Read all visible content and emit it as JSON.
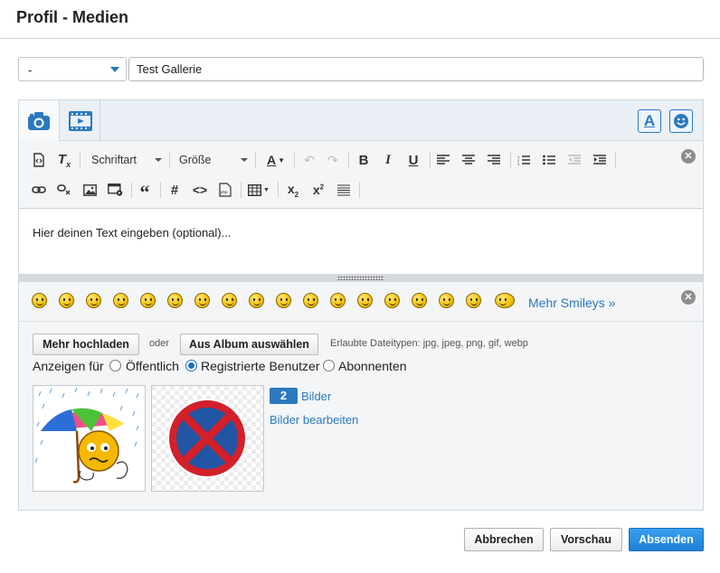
{
  "title": "Profil - Medien",
  "album_select": {
    "value": "-"
  },
  "title_input": {
    "value": "Test Gallerie"
  },
  "media_tabs": {
    "photo_icon": "camera-icon",
    "video_icon": "film-icon"
  },
  "toolbar": {
    "font_label": "Schriftart",
    "size_label": "Größe"
  },
  "editor": {
    "placeholder": "Hier deinen Text eingeben (optional)..."
  },
  "smileys": {
    "count": 18,
    "more_label": "Mehr Smileys »"
  },
  "upload": {
    "upload_more": "Mehr hochladen",
    "or": "oder",
    "from_album": "Aus Album auswählen",
    "allowed_types": "Erlaubte Dateitypen: jpg, jpeg, png, gif, webp",
    "visibility_label": "Anzeigen für",
    "options": [
      {
        "label": "Öffentlich",
        "selected": false
      },
      {
        "label": "Registrierte Benutzer",
        "selected": true
      },
      {
        "label": "Abonnenten",
        "selected": false
      }
    ],
    "image_count": "2",
    "images_label": "Bilder",
    "edit_images": "Bilder bearbeiten"
  },
  "footer": {
    "cancel": "Abbrechen",
    "preview": "Vorschau",
    "submit": "Absenden"
  },
  "colors": {
    "accent": "#2b79bf",
    "primary_button": "#1d7fd6"
  }
}
